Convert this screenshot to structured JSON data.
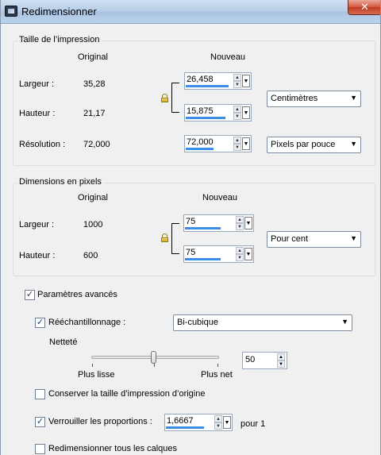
{
  "window": {
    "title": "Redimensionner",
    "close_glyph": "✕"
  },
  "print_size": {
    "group_label": "Taille de l’impression",
    "col_original": "Original",
    "col_new": "Nouveau",
    "width": {
      "label": "Largeur :",
      "original": "35,28",
      "new": "26,458"
    },
    "height": {
      "label": "Hauteur :",
      "original": "21,17",
      "new": "15,875"
    },
    "resolution": {
      "label": "Résolution :",
      "original": "72,000",
      "new": "72,000"
    },
    "unit_select": "Centimètres",
    "resolution_unit_select": "Pixels par pouce"
  },
  "pixel_dims": {
    "group_label": "Dimensions en pixels",
    "col_original": "Original",
    "col_new": "Nouveau",
    "width": {
      "label": "Largeur :",
      "original": "1000",
      "new": "75"
    },
    "height": {
      "label": "Hauteur :",
      "original": "600",
      "new": "75"
    },
    "unit_select": "Pour cent"
  },
  "advanced": {
    "label": "Paramètres avancés",
    "checked": true,
    "resample": {
      "label": "Rééchantillonnage :",
      "checked": true,
      "select": "Bi-cubique"
    },
    "sharpness": {
      "label": "Netteté",
      "min_label": "Plus lisse",
      "max_label": "Plus net",
      "value": "50",
      "level": 0.5
    },
    "keep_print_size": {
      "label": "Conserver la taille d’impression d’origine",
      "checked": false
    },
    "lock_ratio": {
      "label": "Verrouiller les proportions :",
      "checked": true,
      "value": "1,6667",
      "suffix": "pour 1"
    },
    "resize_all_layers": {
      "label": "Redimensionner tous les calques",
      "checked": false
    }
  },
  "icons": {
    "checkmark": "✓",
    "spin_up": "▲",
    "spin_down": "▼",
    "dropdown": "▼",
    "lock": "lock-icon"
  }
}
